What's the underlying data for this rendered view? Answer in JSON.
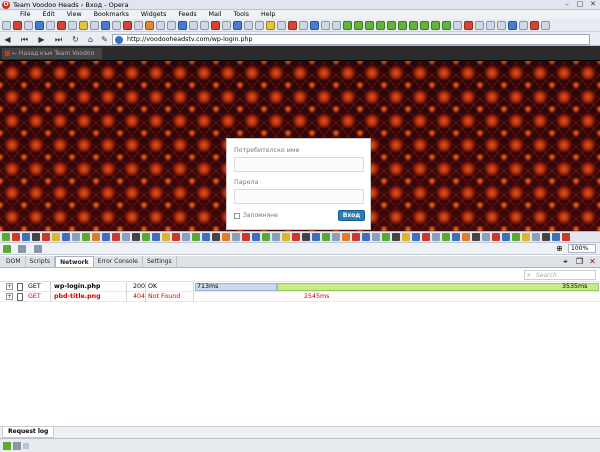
{
  "window": {
    "title": "Team Voodoo Heads › Вход - Opera"
  },
  "menu": [
    "File",
    "Edit",
    "View",
    "Bookmarks",
    "Widgets",
    "Feeds",
    "Mail",
    "Tools",
    "Help"
  ],
  "address": {
    "url": "http://voodooheadstv.com/wp-login.php"
  },
  "page_tab": {
    "label": "← Назад към Team Voodoo Heads"
  },
  "login": {
    "username_label": "Потребителско име",
    "password_label": "Парола",
    "remember_label": "Запомняне",
    "submit_label": "Вход"
  },
  "statusbar": {
    "zoom": "100%"
  },
  "devtools": {
    "tabs": [
      "DOM",
      "Scripts",
      "Network",
      "Error Console",
      "Settings"
    ],
    "active_tab": "Network",
    "search_placeholder": "Search",
    "requests": [
      {
        "method": "GET",
        "file": "wp-login.php",
        "status": "200",
        "status_text": "OK",
        "timing_start": "713ms",
        "timing_total": "3535ms",
        "error": false
      },
      {
        "method": "GET",
        "file": "pbd-title.png",
        "status": "404",
        "status_text": "Not Found",
        "timing_total": "2545ms",
        "error": true
      }
    ],
    "bottom_tab": "Request log"
  }
}
